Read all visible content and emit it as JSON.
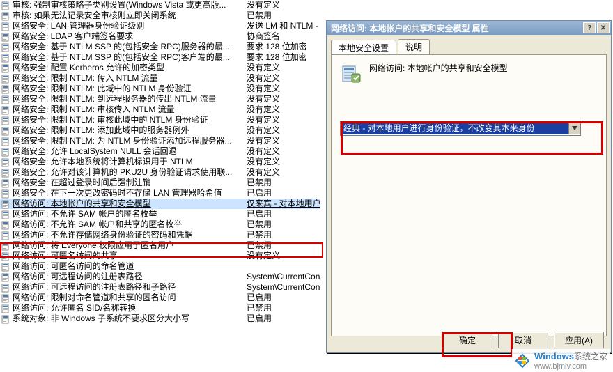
{
  "policies": [
    {
      "name": "审核: 强制审核策略子类别设置(Windows Vista 或更高版...",
      "value": "没有定义"
    },
    {
      "name": "审核: 如果无法记录安全审核则立即关闭系统",
      "value": "已禁用"
    },
    {
      "name": "网络安全: LAN 管理器身份验证级别",
      "value": "发送 LM 和 NTLM - 如"
    },
    {
      "name": "网络安全: LDAP 客户端签名要求",
      "value": "协商签名"
    },
    {
      "name": "网络安全: 基于 NTLM SSP 的(包括安全 RPC)服务器的最...",
      "value": "要求 128 位加密"
    },
    {
      "name": "网络安全: 基于 NTLM SSP 的(包括安全 RPC)客户端的最...",
      "value": "要求 128 位加密"
    },
    {
      "name": "网络安全: 配置 Kerberos 允许的加密类型",
      "value": "没有定义"
    },
    {
      "name": "网络安全: 限制 NTLM: 传入 NTLM 流量",
      "value": "没有定义"
    },
    {
      "name": "网络安全: 限制 NTLM: 此域中的 NTLM 身份验证",
      "value": "没有定义"
    },
    {
      "name": "网络安全: 限制 NTLM: 到远程服务器的传出 NTLM 流量",
      "value": "没有定义"
    },
    {
      "name": "网络安全: 限制 NTLM: 审核传入 NTLM 流量",
      "value": "没有定义"
    },
    {
      "name": "网络安全: 限制 NTLM: 审核此域中的 NTLM 身份验证",
      "value": "没有定义"
    },
    {
      "name": "网络安全: 限制 NTLM: 添加此域中的服务器例外",
      "value": "没有定义"
    },
    {
      "name": "网络安全: 限制 NTLM: 为 NTLM 身份验证添加远程服务器...",
      "value": "没有定义"
    },
    {
      "name": "网络安全: 允许 LocalSystem NULL 会话回退",
      "value": "没有定义"
    },
    {
      "name": "网络安全: 允许本地系统将计算机标识用于 NTLM",
      "value": "没有定义"
    },
    {
      "name": "网络安全: 允许对该计算机的 PKU2U 身份验证请求使用联...",
      "value": "没有定义"
    },
    {
      "name": "网络安全: 在超过登录时间后强制注销",
      "value": "已禁用"
    },
    {
      "name": "网络安全: 在下一次更改密码时不存储 LAN 管理器哈希值",
      "value": "已启用"
    },
    {
      "name": "网络访问: 本地帐户的共享和安全模型",
      "value": "仅来宾 - 对本地用户"
    },
    {
      "name": "网络访问: 不允许 SAM 帐户的匿名枚举",
      "value": "已启用"
    },
    {
      "name": "网络访问: 不允许 SAM 帐户和共享的匿名枚举",
      "value": "已禁用"
    },
    {
      "name": "网络访问: 不允许存储网络身份验证的密码和凭据",
      "value": "已禁用"
    },
    {
      "name": "网络访问: 将 Everyone 权限应用于匿名用户",
      "value": "已禁用"
    },
    {
      "name": "网络访问: 可匿名访问的共享",
      "value": "没有定义"
    },
    {
      "name": "网络访问: 可匿名访问的命名管道",
      "value": ""
    },
    {
      "name": "网络访问: 可远程访问的注册表路径",
      "value": "System\\CurrentContr"
    },
    {
      "name": "网络访问: 可远程访问的注册表路径和子路径",
      "value": "System\\CurrentContr"
    },
    {
      "name": "网络访问: 限制对命名管道和共享的匿名访问",
      "value": "已启用"
    },
    {
      "name": "网络访问: 允许匿名 SID/名称转换",
      "value": "已禁用"
    },
    {
      "name": "系统对象: 非 Windows 子系统不要求区分大小写",
      "value": "已启用"
    }
  ],
  "selectedIndex": 19,
  "dialog": {
    "title": "网络访问: 本地帐户的共享和安全模型 属性",
    "tabs": [
      "本地安全设置",
      "说明"
    ],
    "activeTab": 0,
    "description": "网络访问: 本地帐户的共享和安全模型",
    "selectedOption": "经典 - 对本地用户进行身份验证，不改变其本来身份",
    "buttons": {
      "ok": "确定",
      "cancel": "取消",
      "apply": "应用(A)"
    }
  },
  "watermark": {
    "brand": "Windows",
    "site": "系统之家",
    "url": "www.bjmlv.com"
  }
}
